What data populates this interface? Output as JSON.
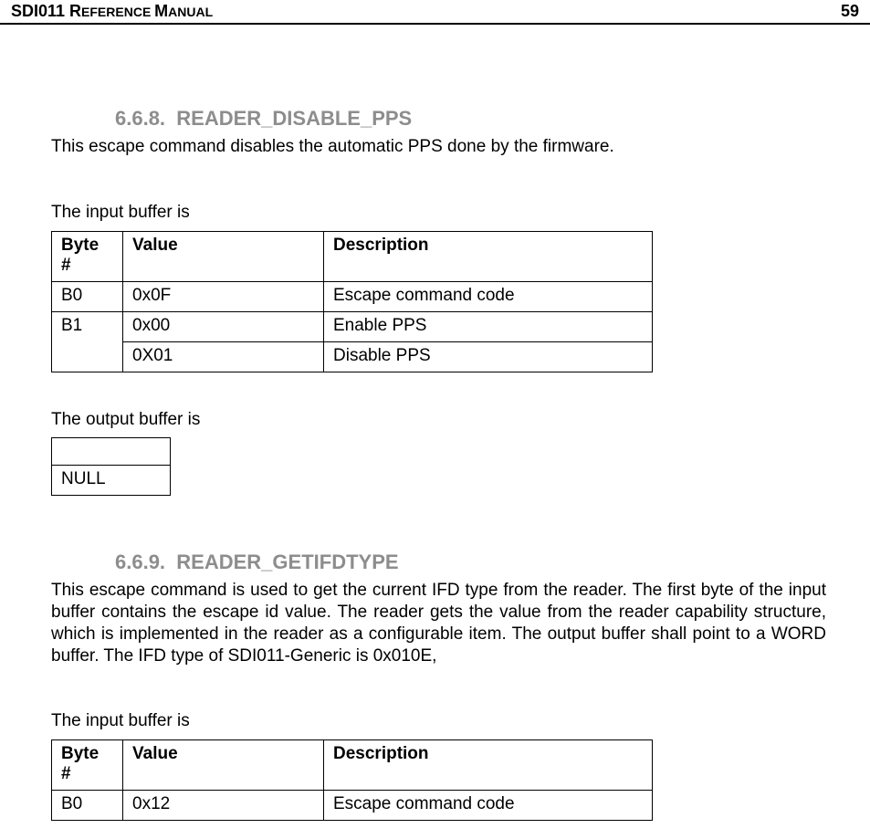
{
  "header": {
    "title_prefix": "SDI011 R",
    "title_smallcaps": "EFERENCE ",
    "title_prefix2": "M",
    "title_smallcaps2": "ANUAL",
    "page_number": "59"
  },
  "section668": {
    "number": "6.6.8.",
    "title": "READER_DISABLE_PPS",
    "intro": "This escape command disables the automatic PPS done by the firmware.",
    "input_label": "The input buffer is",
    "table": {
      "h_byte": "Byte #",
      "h_value": "Value",
      "h_desc": "Description",
      "rows": [
        {
          "byte": "B0",
          "value": "0x0F",
          "desc": "Escape command code"
        },
        {
          "byte": "B1",
          "value": "0x00",
          "desc": "Enable PPS"
        },
        {
          "byte": "",
          "value": "0X01",
          "desc": "Disable PPS"
        }
      ]
    },
    "output_label": "The output buffer is",
    "null_text": "NULL"
  },
  "section669": {
    "number": "6.6.9.",
    "title": "READER_GETIFDTYPE",
    "intro": "This escape command is used to get the current IFD type from the reader. The first byte of the input buffer contains the escape id value. The reader gets the value from the reader capability structure, which is implemented in the reader as a configurable item. The output buffer shall point to a WORD buffer. The IFD type of SDI011-Generic is 0x010E,",
    "input_label": "The input buffer is",
    "table": {
      "h_byte": "Byte #",
      "h_value": "Value",
      "h_desc": "Description",
      "rows": [
        {
          "byte": "B0",
          "value": "0x12",
          "desc": "Escape command code"
        }
      ]
    }
  }
}
